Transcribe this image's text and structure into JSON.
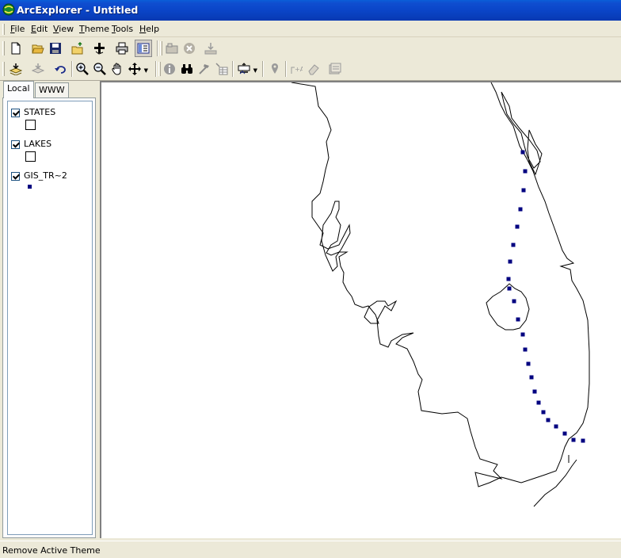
{
  "window": {
    "title": "ArcExplorer - Untitled"
  },
  "menu": [
    "File",
    "Edit",
    "View",
    "Theme",
    "Tools",
    "Help"
  ],
  "toolbar1": [
    {
      "name": "new-map-button",
      "icon": "new-document-icon"
    },
    {
      "name": "open-button",
      "icon": "open-folder-icon"
    },
    {
      "name": "save-button",
      "icon": "save-disk-icon"
    },
    {
      "name": "open-project-button",
      "icon": "folder-up-icon"
    },
    {
      "name": "add-theme-button",
      "icon": "add-plus-icon"
    },
    {
      "name": "print-button",
      "icon": "printer-icon"
    },
    {
      "name": "toggle-legend-button",
      "icon": "legend-panel-icon"
    },
    {
      "name": "catalog-button",
      "icon": "catalog-icon"
    },
    {
      "name": "cancel-button",
      "icon": "cancel-x-icon"
    },
    {
      "name": "export-button",
      "icon": "download-icon"
    }
  ],
  "toolbar2": [
    {
      "name": "theme-properties-button",
      "icon": "layers-edit-icon"
    },
    {
      "name": "theme-remove-button",
      "icon": "layers-down-icon"
    },
    {
      "name": "undo-button",
      "icon": "undo-arrow-icon"
    },
    {
      "name": "zoom-in-button",
      "icon": "zoom-in-icon"
    },
    {
      "name": "zoom-out-button",
      "icon": "zoom-out-icon"
    },
    {
      "name": "pan-button",
      "icon": "hand-icon"
    },
    {
      "name": "full-extent-button",
      "icon": "move-arrows-icon"
    },
    {
      "name": "identify-button",
      "icon": "info-icon"
    },
    {
      "name": "find-button",
      "icon": "binoculars-icon"
    },
    {
      "name": "measure-button",
      "icon": "hammer-icon"
    },
    {
      "name": "query-button",
      "icon": "query-table-icon"
    },
    {
      "name": "select-button",
      "icon": "select-features-icon"
    },
    {
      "name": "locate-button",
      "icon": "pin-icon"
    },
    {
      "name": "label-button",
      "icon": "label-icon"
    },
    {
      "name": "erase-button",
      "icon": "eraser-icon"
    },
    {
      "name": "properties-button",
      "icon": "properties-icon"
    }
  ],
  "legend": {
    "tabs": [
      "Local",
      "WWW"
    ],
    "layers": [
      {
        "name": "STATES",
        "checked": true,
        "symbol": "polygon"
      },
      {
        "name": "LAKES",
        "checked": true,
        "symbol": "polygon"
      },
      {
        "name": "GIS_TR~2",
        "checked": true,
        "symbol": "point"
      }
    ]
  },
  "map": {
    "point_color": "#000080",
    "line_color": "#000000"
  },
  "status": {
    "text": "Remove Active Theme"
  }
}
